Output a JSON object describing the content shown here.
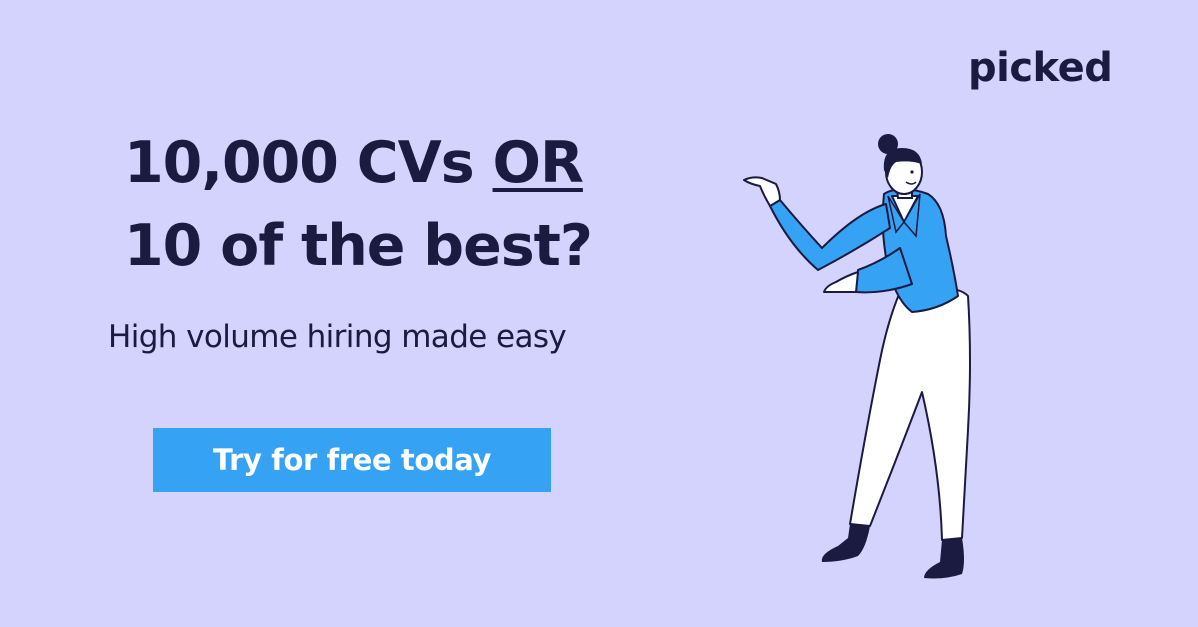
{
  "brand": {
    "logo_text": "picked"
  },
  "hero": {
    "headline_line1_prefix": "10,000 CVs ",
    "headline_line1_emphasis": "OR",
    "headline_line2": "10 of the best?",
    "subheadline": "High volume hiring made easy",
    "cta_label": "Try for free today"
  },
  "colors": {
    "background": "#d4d3fe",
    "text": "#1b1a40",
    "accent": "#35a2f4"
  },
  "illustration": {
    "icon": "presenting-woman-illustration"
  }
}
